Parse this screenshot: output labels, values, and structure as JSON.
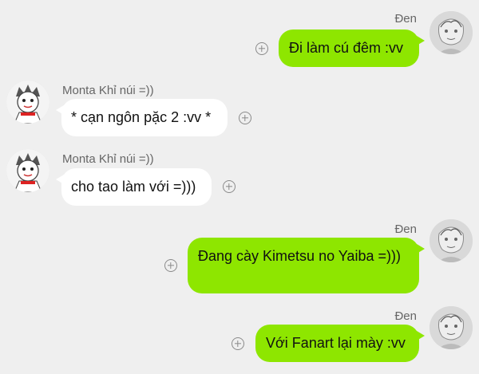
{
  "messages": [
    {
      "sender": "Đen",
      "text": "Đi làm cú đêm :vv",
      "mine": true
    },
    {
      "sender": "Monta Khỉ núi =))",
      "text": "* cạn ngôn pặc 2 :vv *",
      "mine": false
    },
    {
      "sender": "Monta Khỉ núi =))",
      "text": "cho tao làm với =)))",
      "mine": false
    },
    {
      "sender": "Đen",
      "text": "Đang cày Kimetsu no Yaiba =)))",
      "mine": true
    },
    {
      "sender": "Đen",
      "text": "Với Fanart lại mày :vv",
      "mine": true
    }
  ],
  "icons": {
    "react": "add-circle-icon",
    "avatar_mine": "sketch-face-avatar",
    "avatar_theirs": "cartoon-monkey-avatar"
  },
  "colors": {
    "background": "#efefef",
    "mine_bubble": "#8ee600",
    "theirs_bubble": "#ffffff",
    "sender_name": "#666666"
  }
}
